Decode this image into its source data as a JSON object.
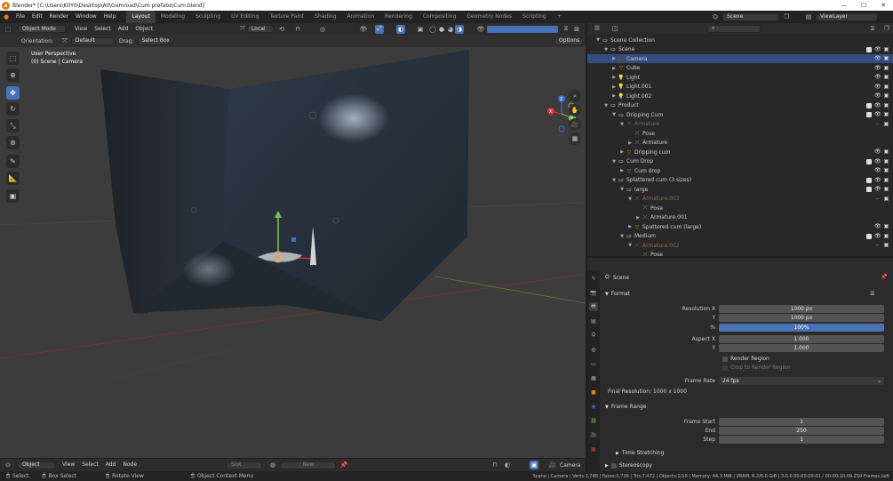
{
  "titlebar": {
    "title": "Blender* [C:\\Users\\K0Y0\\Desktop\\All\\Gumroad\\Cum prefabs\\Cum.blend]",
    "minimize": "—",
    "maximize": "☐",
    "close": "✕"
  },
  "menubar": {
    "menus": [
      "File",
      "Edit",
      "Render",
      "Window",
      "Help"
    ],
    "workspaces": [
      "Layout",
      "Modeling",
      "Sculpting",
      "UV Editing",
      "Texture Paint",
      "Shading",
      "Animation",
      "Rendering",
      "Compositing",
      "Geometry Nodes",
      "Scripting"
    ],
    "active_workspace": "Layout",
    "add_tab": "+",
    "scene": "Scene",
    "view_layer": "ViewLayer"
  },
  "viewport_header": {
    "mode": "Object Mode",
    "menus": [
      "View",
      "Select",
      "Add",
      "Object"
    ],
    "transform": "Local",
    "orientation_label": "Orientation:",
    "orientation_value": "Default",
    "drag_label": "Drag:",
    "drag_value": "Select Box",
    "options": "Options"
  },
  "viewport": {
    "overlay_line1": "User Perspective",
    "overlay_line2": "(0) Scene | Camera",
    "gizmo_axes": [
      "X",
      "Y",
      "Z"
    ],
    "tools": [
      "select-box",
      "cursor",
      "move",
      "rotate",
      "scale",
      "transform",
      "annotate",
      "measure",
      "add-cube"
    ],
    "active_tool": "move"
  },
  "outliner": {
    "search_placeholder": "",
    "rows": [
      {
        "label": "Scene Collection",
        "depth": 0,
        "icon": "collection",
        "expanded": true,
        "sel": false,
        "vis": false
      },
      {
        "label": "Scene",
        "depth": 1,
        "icon": "collection",
        "expanded": true,
        "sel": false,
        "vis": true
      },
      {
        "label": "Camera",
        "depth": 2,
        "icon": "camera",
        "expanded": false,
        "sel": true,
        "vis": true
      },
      {
        "label": "Cube",
        "depth": 2,
        "icon": "mesh",
        "expanded": false,
        "sel": false,
        "vis": true
      },
      {
        "label": "Light",
        "depth": 2,
        "icon": "light",
        "expanded": false,
        "sel": false,
        "vis": true
      },
      {
        "label": "Light.001",
        "depth": 2,
        "icon": "light",
        "expanded": false,
        "sel": false,
        "vis": true
      },
      {
        "label": "Light.002",
        "depth": 2,
        "icon": "light",
        "expanded": false,
        "sel": false,
        "vis": true
      },
      {
        "label": "Product",
        "depth": 1,
        "icon": "collection",
        "expanded": true,
        "sel": false,
        "vis": true
      },
      {
        "label": "Dripping Cum",
        "depth": 2,
        "icon": "collection",
        "expanded": true,
        "sel": false,
        "vis": true
      },
      {
        "label": "Armature",
        "depth": 3,
        "icon": "armature-dim",
        "expanded": true,
        "sel": false,
        "vis": "hidden"
      },
      {
        "label": "Pose",
        "depth": 4,
        "icon": "pose",
        "expanded": null,
        "sel": false,
        "vis": false
      },
      {
        "label": "Armature",
        "depth": 4,
        "icon": "armature",
        "expanded": false,
        "sel": false,
        "vis": false
      },
      {
        "label": "Dripping cum",
        "depth": 3,
        "icon": "mesh",
        "expanded": false,
        "sel": false,
        "vis": true
      },
      {
        "label": "Cum Drop",
        "depth": 2,
        "icon": "collection",
        "expanded": true,
        "sel": false,
        "vis": true
      },
      {
        "label": "Cum drop",
        "depth": 3,
        "icon": "mesh",
        "expanded": false,
        "sel": false,
        "vis": true
      },
      {
        "label": "Splattered cum (3 sizes)",
        "depth": 2,
        "icon": "collection",
        "expanded": true,
        "sel": false,
        "vis": true
      },
      {
        "label": "large",
        "depth": 3,
        "icon": "collection",
        "expanded": true,
        "sel": false,
        "vis": true
      },
      {
        "label": "Armature.003",
        "depth": 4,
        "icon": "armature-dim",
        "expanded": true,
        "sel": false,
        "vis": "hidden"
      },
      {
        "label": "Pose",
        "depth": 5,
        "icon": "pose",
        "expanded": null,
        "sel": false,
        "vis": false
      },
      {
        "label": "Armature.001",
        "depth": 5,
        "icon": "armature",
        "expanded": false,
        "sel": false,
        "vis": false
      },
      {
        "label": "Spattered cum (large)",
        "depth": 4,
        "icon": "mesh",
        "expanded": false,
        "sel": false,
        "vis": true
      },
      {
        "label": "Medium",
        "depth": 3,
        "icon": "collection",
        "expanded": true,
        "sel": false,
        "vis": true
      },
      {
        "label": "Armature.002",
        "depth": 4,
        "icon": "armature-dim",
        "expanded": true,
        "sel": false,
        "vis": "hidden"
      },
      {
        "label": "Pose",
        "depth": 5,
        "icon": "pose",
        "expanded": null,
        "sel": false,
        "vis": false
      }
    ]
  },
  "properties": {
    "breadcrumb": "Scene",
    "format": {
      "header": "Format",
      "res_x_label": "Resolution X",
      "res_x": "1000 px",
      "res_y_label": "Y",
      "res_y": "1000 px",
      "pct_label": "%",
      "pct": "100%",
      "aspect_x_label": "Aspect X",
      "aspect_x": "1.000",
      "aspect_y_label": "Y",
      "aspect_y": "1.000",
      "render_region": "Render Region",
      "crop_region": "Crop to Render Region",
      "frame_rate_label": "Frame Rate",
      "frame_rate": "24 fps",
      "final_resolution": "Final Resolution: 1000 x 1000"
    },
    "frame_range": {
      "header": "Frame Range",
      "start_label": "Frame Start",
      "start": "1",
      "end_label": "End",
      "end": "250",
      "step_label": "Step",
      "step": "1"
    },
    "time_stretching": "Time Stretching",
    "stereoscopy": "Stereoscopy"
  },
  "timeline_header": {
    "mode": "Object",
    "menus": [
      "View",
      "Select",
      "Add",
      "Node"
    ],
    "slot": "Slot",
    "new": "New",
    "camera": "Camera"
  },
  "statusbar": {
    "select": "Select",
    "box_select": "Box Select",
    "rotate_view": "Rotate View",
    "context_menu": "Object Context Menu",
    "stats": "Scene | Camera | Verts:3,748 | Faces:3,736 | Tris:7,472 | Objects:1/10 | Memory: 44.3 MiB | VRAM: 6.2/8.0 GiB | 3.0.0 00:00:00:01 / 00:00:10:09 250 Frames Left"
  },
  "colors": {
    "accent": "#4772b3",
    "selected_row": "#334d80",
    "blender_orange": "#e87d0d"
  }
}
